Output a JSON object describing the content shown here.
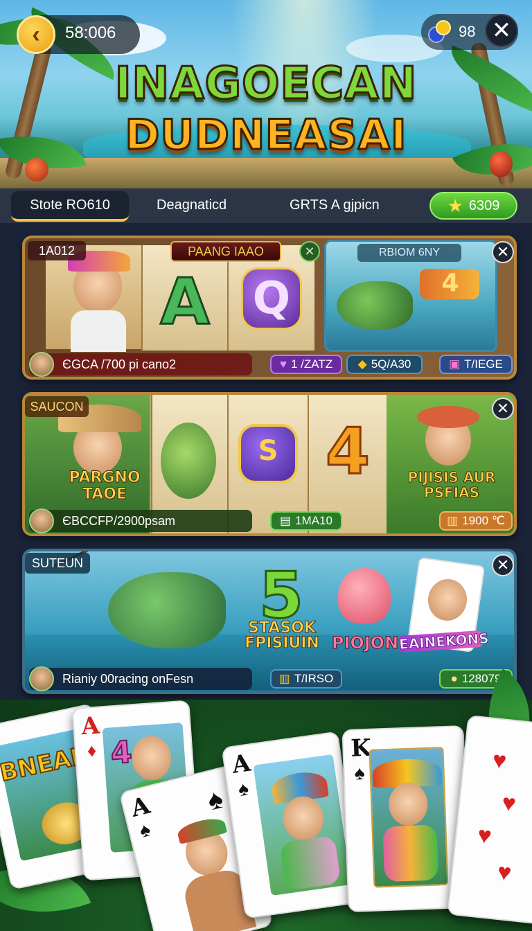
{
  "header": {
    "timer": "58:006",
    "coins": "98",
    "title_line1": "INAGOECAN",
    "title_line2": "DUDNEASAI"
  },
  "tabs": [
    {
      "label": "Stote RO610",
      "active": true
    },
    {
      "label": "Deagnaticd",
      "active": false
    },
    {
      "label": "GRTS A gjpicn",
      "active": false
    }
  ],
  "score": "6309",
  "cards": [
    {
      "tag": "1A012",
      "title": "PAANG IAAO",
      "side_title": "RBIOM 6NY",
      "slot_letters": [
        "A",
        "Q",
        "4"
      ],
      "footer": "ЄGCA /700 pi cano2",
      "chips": [
        "1 /ZATZ",
        "5Q/A30",
        "T/IEGE"
      ]
    },
    {
      "tag": "SAUCON",
      "slot_letters": [
        "S",
        "4"
      ],
      "left_caption": "PARGNO TAOE",
      "right_caption": "PIJISIS AUR PSFIAS",
      "footer": "ЄBCCFP/2900psam",
      "chips": [
        "1MA10",
        "1900 ℃"
      ]
    },
    {
      "tag": "SUTEUN",
      "big_number": "5",
      "captions": [
        "STASOK FPISIUIN",
        "PIOJON",
        "EAINEKONS"
      ],
      "footer": "Rianiy 00racing onFesn",
      "chips": [
        "T/IRSO",
        "128079"
      ]
    }
  ],
  "bottom_cards": [
    {
      "rank": "",
      "text": "BNEAN",
      "suit": ""
    },
    {
      "rank": "A",
      "text": "4",
      "suit": "♦"
    },
    {
      "rank": "A",
      "text": "",
      "suit": "♠"
    },
    {
      "rank": "A",
      "text": "",
      "suit": "♠"
    },
    {
      "rank": "K",
      "text": "",
      "suit": "♠"
    },
    {
      "rank": "",
      "text": "",
      "suit": "♥"
    }
  ],
  "colors": {
    "accent_gold": "#f7c63a",
    "score_green": "#2f9a22",
    "panel_border": "#b9873b"
  },
  "icons": [
    "back-arrow-icon",
    "coin-icon",
    "close-icon",
    "star-icon",
    "heart-icon",
    "gem-icon",
    "scroll-icon"
  ]
}
